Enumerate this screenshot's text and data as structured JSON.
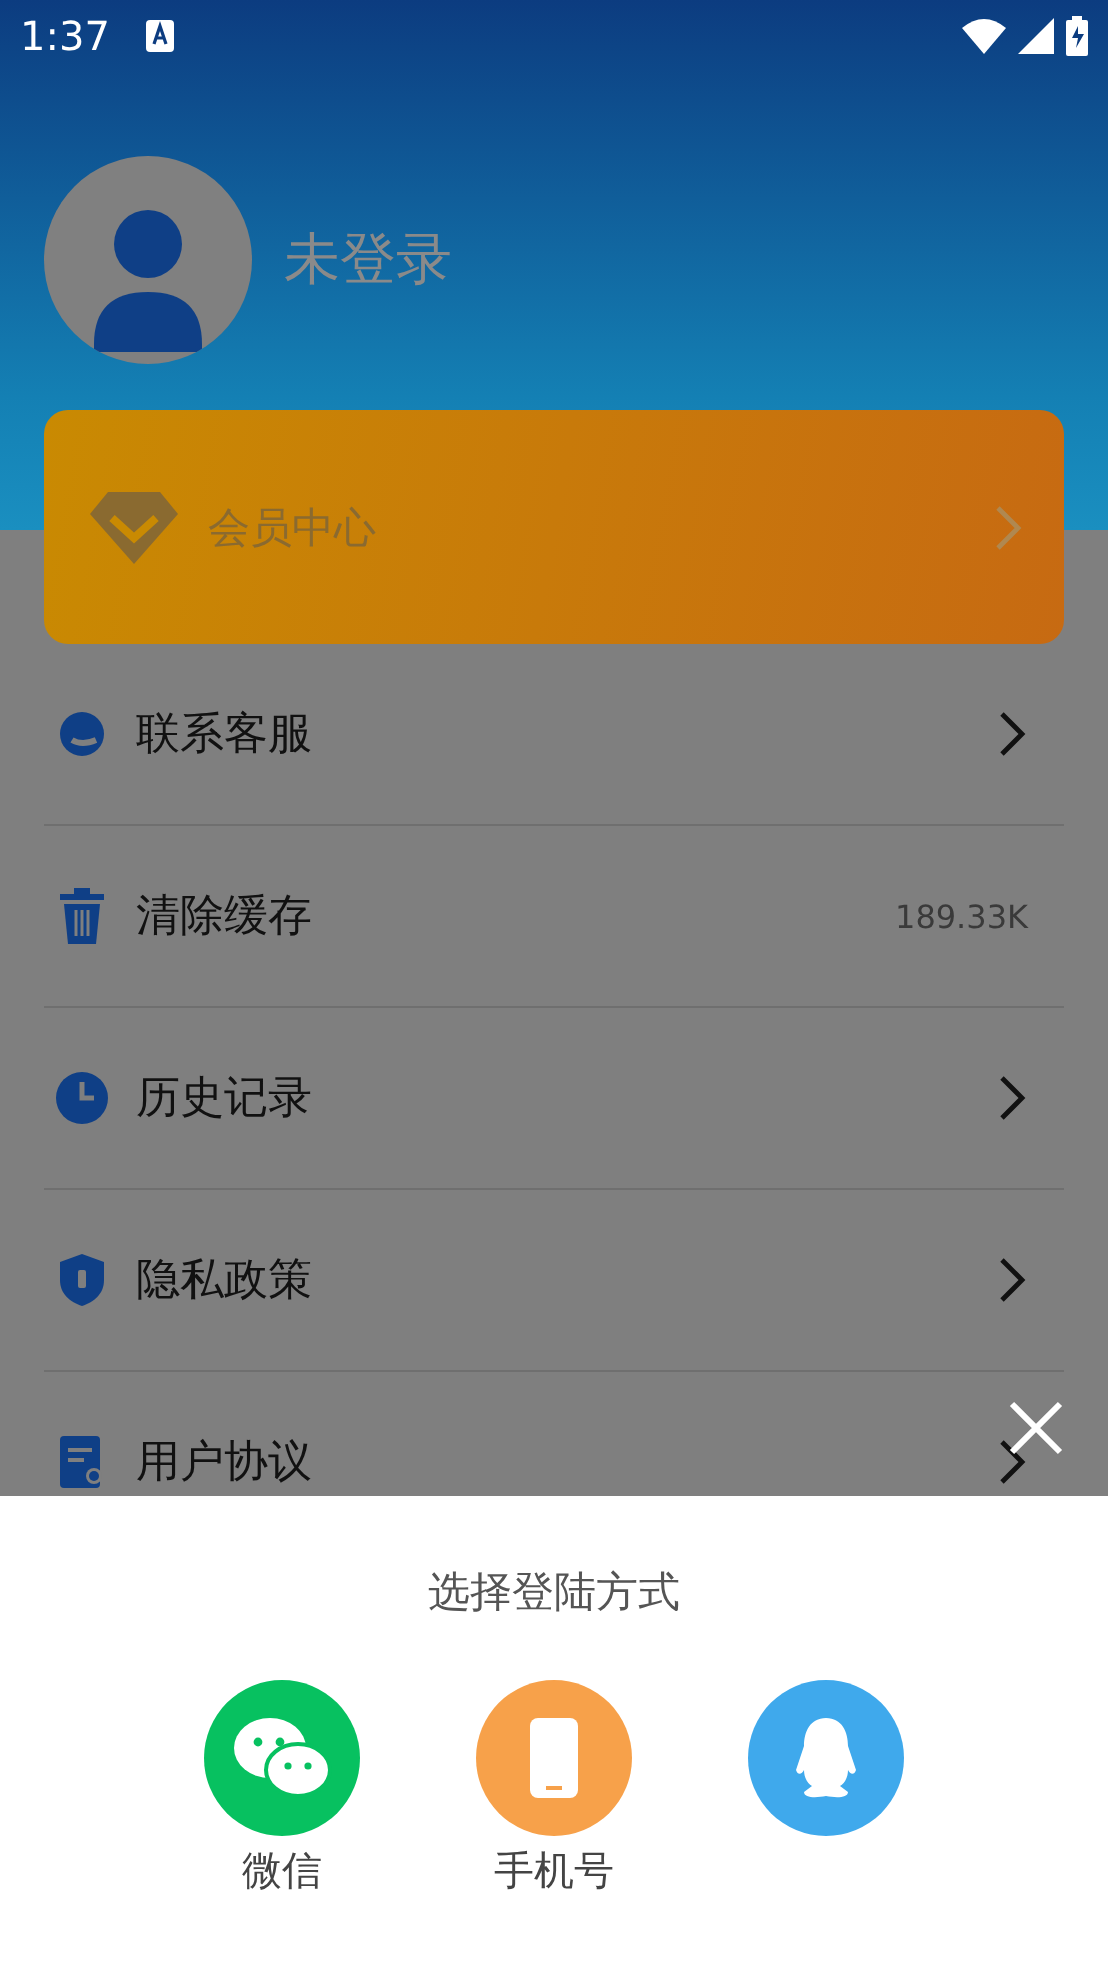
{
  "status_bar": {
    "time": "1:37"
  },
  "profile": {
    "name": "未登录"
  },
  "member_card": {
    "label": "会员中心"
  },
  "menu": [
    {
      "label": "联系客服",
      "kind": "link"
    },
    {
      "label": "清除缓存",
      "kind": "value",
      "value": "189.33K"
    },
    {
      "label": "历史记录",
      "kind": "link"
    },
    {
      "label": "隐私政策",
      "kind": "link"
    },
    {
      "label": "用户协议",
      "kind": "link"
    }
  ],
  "login_sheet": {
    "title": "选择登陆方式",
    "options": [
      {
        "kind": "wechat",
        "label": "微信"
      },
      {
        "kind": "phone",
        "label": "手机号"
      },
      {
        "kind": "qq"
      }
    ]
  }
}
